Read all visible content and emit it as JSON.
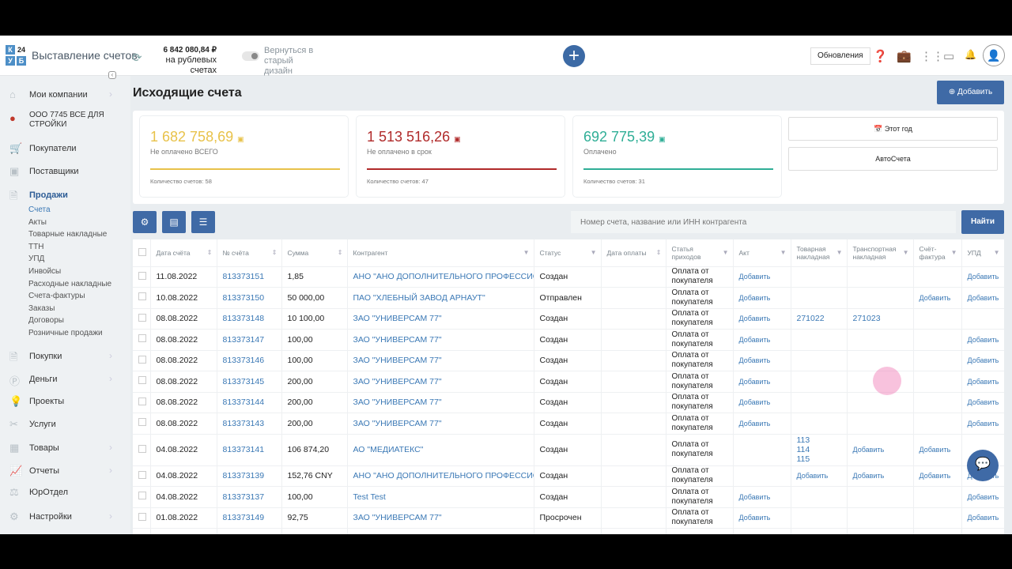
{
  "header": {
    "app_title": "Выставление счетов",
    "balance": "6 842 080,84 ₽",
    "balance_caption": "на рублевых счетах",
    "old_design": "Вернуться в старый дизайн",
    "updates": "Обновления"
  },
  "sidebar": {
    "items": [
      {
        "label": "Мои компании",
        "icon": "home-icon"
      },
      {
        "label": "ООО 7745 ВСЕ ДЛЯ СТРОЙКИ",
        "icon": "company-icon"
      },
      {
        "label": "Покупатели",
        "icon": "cart-icon"
      },
      {
        "label": "Поставщики",
        "icon": "supplier-icon"
      },
      {
        "label": "Продажи",
        "icon": "sales-icon"
      },
      {
        "label": "Покупки",
        "icon": "purchases-icon"
      },
      {
        "label": "Деньги",
        "icon": "money-icon"
      },
      {
        "label": "Проекты",
        "icon": "bulb-icon"
      },
      {
        "label": "Услуги",
        "icon": "tools-icon"
      },
      {
        "label": "Товары",
        "icon": "box-icon"
      },
      {
        "label": "Отчеты",
        "icon": "chart-icon"
      },
      {
        "label": "ЮрОтдел",
        "icon": "scales-icon"
      },
      {
        "label": "Настройки",
        "icon": "gear-icon"
      }
    ],
    "sales_sub": [
      "Счета",
      "Акты",
      "Товарные накладные",
      "ТТН",
      "УПД",
      "Инвойсы",
      "Расходные накладные",
      "Счета-фактуры",
      "Заказы",
      "Договоры",
      "Розничные продажи"
    ]
  },
  "main": {
    "title": "Исходящие счета",
    "add_label": "Добавить",
    "cards": [
      {
        "amount": "1 682 758,69",
        "caption": "Не оплачено ВСЕГО",
        "count": "Количество счетов: 58",
        "color": "#e8c24a"
      },
      {
        "amount": "1 513 516,26",
        "caption": "Не оплачено в срок",
        "count": "Количество счетов: 47",
        "color": "#b02a2a"
      },
      {
        "amount": "692 775,39",
        "caption": "Оплачено",
        "count": "Количество счетов: 31",
        "color": "#2fae96"
      }
    ],
    "period": "Этот год",
    "auto": "АвтоСчета",
    "search_placeholder": "Номер счета, название или ИНН контрагента",
    "find": "Найти"
  },
  "table": {
    "columns": [
      "Дата счёта",
      "№ счёта",
      "Сумма",
      "Контрагент",
      "Статус",
      "Дата оплаты",
      "Статья приходов",
      "Акт",
      "Товарная накладная",
      "Транспортная накладная",
      "Счёт-фактура",
      "УПД"
    ],
    "rows": [
      {
        "date": "11.08.2022",
        "num": "813373151",
        "sum": "1,85",
        "contractor": "АНО \"АНО ДОПОЛНИТЕЛЬНОГО ПРОФЕССИОНАЛ",
        "status": "Создан",
        "paid": "",
        "article": "Оплата от покупателя",
        "act": "Добавить",
        "tov": "",
        "trans": "",
        "sf": "",
        "upd": "Добавить"
      },
      {
        "date": "10.08.2022",
        "num": "813373150",
        "sum": "50 000,00",
        "contractor": "ПАО \"ХЛЕБНЫЙ ЗАВОД АРНАУТ\"",
        "status": "Отправлен",
        "paid": "",
        "article": "Оплата от покупателя",
        "act": "Добавить",
        "tov": "",
        "trans": "",
        "sf": "Добавить",
        "upd": "Добавить"
      },
      {
        "date": "08.08.2022",
        "num": "813373148",
        "sum": "10 100,00",
        "contractor": "ЗАО \"УНИВЕРСАМ 77\"",
        "status": "Создан",
        "paid": "",
        "article": "Оплата от покупателя",
        "act": "Добавить",
        "tov": "271022",
        "trans": "271023",
        "sf": "",
        "upd": ""
      },
      {
        "date": "08.08.2022",
        "num": "813373147",
        "sum": "100,00",
        "contractor": "ЗАО \"УНИВЕРСАМ 77\"",
        "status": "Создан",
        "paid": "",
        "article": "Оплата от покупателя",
        "act": "Добавить",
        "tov": "",
        "trans": "",
        "sf": "",
        "upd": "Добавить"
      },
      {
        "date": "08.08.2022",
        "num": "813373146",
        "sum": "100,00",
        "contractor": "ЗАО \"УНИВЕРСАМ 77\"",
        "status": "Создан",
        "paid": "",
        "article": "Оплата от покупателя",
        "act": "Добавить",
        "tov": "",
        "trans": "",
        "sf": "",
        "upd": "Добавить"
      },
      {
        "date": "08.08.2022",
        "num": "813373145",
        "sum": "200,00",
        "contractor": "ЗАО \"УНИВЕРСАМ 77\"",
        "status": "Создан",
        "paid": "",
        "article": "Оплата от покупателя",
        "act": "Добавить",
        "tov": "",
        "trans": "",
        "sf": "",
        "upd": "Добавить"
      },
      {
        "date": "08.08.2022",
        "num": "813373144",
        "sum": "200,00",
        "contractor": "ЗАО \"УНИВЕРСАМ 77\"",
        "status": "Создан",
        "paid": "",
        "article": "Оплата от покупателя",
        "act": "Добавить",
        "tov": "",
        "trans": "",
        "sf": "",
        "upd": "Добавить"
      },
      {
        "date": "08.08.2022",
        "num": "813373143",
        "sum": "200,00",
        "contractor": "ЗАО \"УНИВЕРСАМ 77\"",
        "status": "Создан",
        "paid": "",
        "article": "Оплата от покупателя",
        "act": "Добавить",
        "tov": "",
        "trans": "",
        "sf": "",
        "upd": "Добавить"
      },
      {
        "date": "04.08.2022",
        "num": "813373141",
        "sum": "106 874,20",
        "contractor": "АО \"МЕДИАТЕКС\"",
        "status": "Создан",
        "paid": "",
        "article": "Оплата от покупателя",
        "act": "",
        "tov": "113\n114\n115",
        "trans": "Добавить",
        "sf": "Добавить",
        "upd": ""
      },
      {
        "date": "04.08.2022",
        "num": "813373139",
        "sum": "152,76 CNY",
        "contractor": "АНО \"АНО ДОПОЛНИТЕЛЬНОГО ПРОФЕССИОНАЛ",
        "status": "Создан",
        "paid": "",
        "article": "Оплата от покупателя",
        "act": "",
        "tov": "Добавить",
        "trans": "Добавить",
        "sf": "Добавить",
        "upd": "Добавить"
      },
      {
        "date": "04.08.2022",
        "num": "813373137",
        "sum": "100,00",
        "contractor": "Test Test",
        "status": "Создан",
        "paid": "",
        "article": "Оплата от покупателя",
        "act": "Добавить",
        "tov": "",
        "trans": "",
        "sf": "",
        "upd": "Добавить"
      },
      {
        "date": "01.08.2022",
        "num": "813373149",
        "sum": "92,75",
        "contractor": "ЗАО \"УНИВЕРСАМ 77\"",
        "status": "Просрочен",
        "paid": "",
        "article": "Оплата от покупателя",
        "act": "Добавить",
        "tov": "",
        "trans": "",
        "sf": "",
        "upd": "Добавить"
      }
    ]
  }
}
